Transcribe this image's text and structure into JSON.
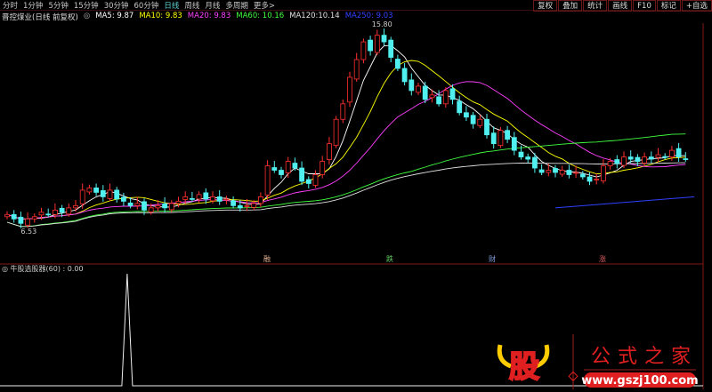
{
  "toolbar": {
    "periods": [
      "分时",
      "1分钟",
      "5分钟",
      "15分钟",
      "30分钟",
      "60分钟",
      "日线",
      "周线",
      "月线",
      "多周期",
      "更多>"
    ],
    "active": "日线",
    "right_buttons": [
      "复权",
      "叠加",
      "统计",
      "画线",
      "F10",
      "标记",
      "+自选"
    ]
  },
  "legend": {
    "title": "晋控煤业(日线 前复权)",
    "items": [
      {
        "label": "MA5: 9.87",
        "color": "#ffffff"
      },
      {
        "label": "MA10: 9.83",
        "color": "#ffff00"
      },
      {
        "label": "MA20: 9.83",
        "color": "#ff40ff"
      },
      {
        "label": "MA60: 10.16",
        "color": "#40ff40"
      },
      {
        "label": "MA120:10.14",
        "color": "#e0e0e0"
      },
      {
        "label": "MA250: 9.03",
        "color": "#3040ff"
      }
    ]
  },
  "chart_data": {
    "type": "candlestick",
    "closes": [
      7.2,
      7.0,
      6.8,
      7.0,
      7.1,
      7.3,
      7.2,
      7.4,
      7.3,
      7.5,
      7.6,
      8.3,
      8.4,
      8.2,
      8.0,
      8.3,
      7.9,
      7.8,
      7.6,
      7.7,
      7.4,
      7.5,
      7.6,
      7.5,
      7.7,
      7.8,
      8.0,
      7.9,
      8.1,
      7.9,
      8.0,
      7.8,
      7.9,
      7.6,
      7.5,
      7.6,
      7.7,
      8.0,
      9.4,
      9.2,
      9.0,
      9.6,
      9.3,
      8.7,
      8.6,
      9.0,
      9.6,
      10.4,
      11.5,
      12.2,
      13.4,
      14.2,
      15.0,
      14.6,
      15.3,
      15.0,
      14.3,
      13.8,
      13.2,
      12.8,
      13.0,
      12.4,
      12.6,
      12.2,
      12.8,
      12.4,
      11.8,
      11.6,
      11.3,
      11.5,
      10.8,
      10.4,
      11.0,
      10.6,
      10.1,
      9.8,
      9.7,
      9.3,
      9.1,
      9.2,
      9.1,
      9.2,
      9.0,
      9.1,
      8.9,
      8.7,
      8.8,
      9.4,
      9.6,
      9.5,
      9.8,
      9.7,
      9.6,
      9.8,
      9.7,
      9.9,
      9.8,
      10.1,
      9.8,
      9.7
    ],
    "high_label": "15.80",
    "low_label": "6.53",
    "high_value": 15.8,
    "low_value": 6.53,
    "markers": [
      {
        "text": "融",
        "color": "#e0b090"
      },
      {
        "text": "跌",
        "color": "#60d060"
      },
      {
        "text": "财",
        "color": "#80a0e0"
      },
      {
        "text": "涨",
        "color": "#e06060"
      }
    ],
    "up_color": "#ff3030",
    "down_color": "#50f0f0"
  },
  "indicator": {
    "label": "牛股选股器(60) : 0.00",
    "signal_index": 17,
    "signal_value": 1
  },
  "logo": {
    "char": "股",
    "name": "公式之家",
    "url": "www.gszj100.com"
  }
}
